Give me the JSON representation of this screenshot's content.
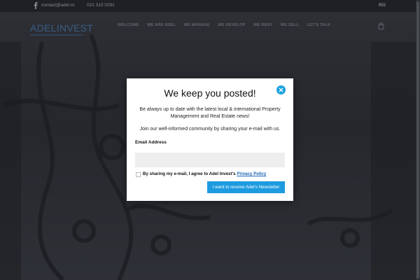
{
  "topbar": {
    "email": "contact@adel.ro",
    "phone": "021 310 0291",
    "language": "RO",
    "social_icon": "facebook-icon"
  },
  "header": {
    "logo_text": "ADELINVEST",
    "nav": [
      "WELCOME",
      "WE ARE ADEL",
      "WE MANAGE",
      "WE DEVELOP",
      "WE RENT",
      "WE SELL",
      "LET'S TALK"
    ],
    "account_icon": "lock-icon"
  },
  "modal": {
    "title": "We keep you posted!",
    "description": "Be always up to date with the latest local & international Property Management and Real Estate news!",
    "invite": "Join our well-informed community by sharing your e-mail with us.",
    "email_label": "Email Address",
    "email_value": "",
    "consent_text": "By sharing my e-mail, I agree to Adel Invest's",
    "consent_link": "Privacy Policy",
    "submit_label": "I want to receive Adel's Newsletter",
    "close_icon": "close-icon"
  },
  "colors": {
    "accent": "#1d9be0",
    "link": "#1a63b6",
    "logo": "#4f8fd1",
    "topbar": "#1f2226"
  }
}
